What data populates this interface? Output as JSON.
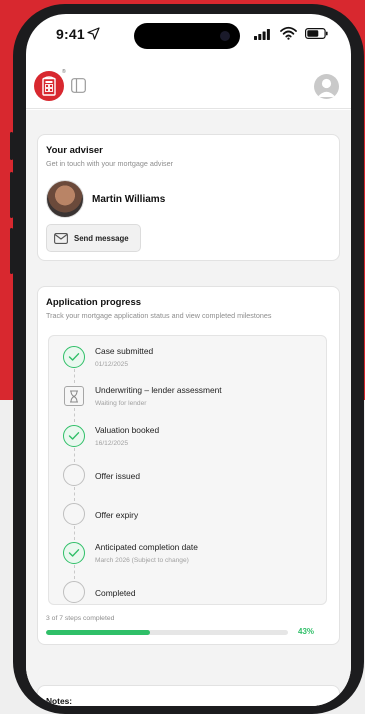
{
  "status_bar": {
    "time": "9:41"
  },
  "colors": {
    "brand_red": "#d8282f",
    "success_green": "#2fbf68",
    "muted_text": "#8d8d8d"
  },
  "header": {
    "logo_icon": "telephone-box-logo-icon",
    "logo_reg": "®",
    "sidebar_icon": "sidebar-toggle-icon",
    "profile_icon": "user-avatar-icon"
  },
  "adviser_card": {
    "title": "Your adviser",
    "subtitle": "Get in touch with your mortgage adviser",
    "adviser_name": "Martin Williams",
    "send_button_label": "Send message",
    "send_button_icon": "mail-icon"
  },
  "progress_card": {
    "title": "Application progress",
    "subtitle": "Track your mortgage application status and view completed milestones",
    "steps": [
      {
        "name": "Case submitted",
        "detail": "01/12/2025",
        "status": "done"
      },
      {
        "name": "Underwriting – lender assessment",
        "detail": "Waiting for lender",
        "status": "waiting"
      },
      {
        "name": "Valuation booked",
        "detail": "16/12/2025",
        "status": "done"
      },
      {
        "name": "Offer issued",
        "detail": "",
        "status": "pending"
      },
      {
        "name": "Offer expiry",
        "detail": "",
        "status": "pending"
      },
      {
        "name": "Anticipated completion date",
        "detail": "March 2026 (Subject to change)",
        "status": "done"
      },
      {
        "name": "Completed",
        "detail": "",
        "status": "pending"
      }
    ],
    "steps_completed_text": "3 of 7 steps completed",
    "progress_percent": 43,
    "progress_percent_label": "43%"
  },
  "notes_card": {
    "title": "Notes:"
  }
}
